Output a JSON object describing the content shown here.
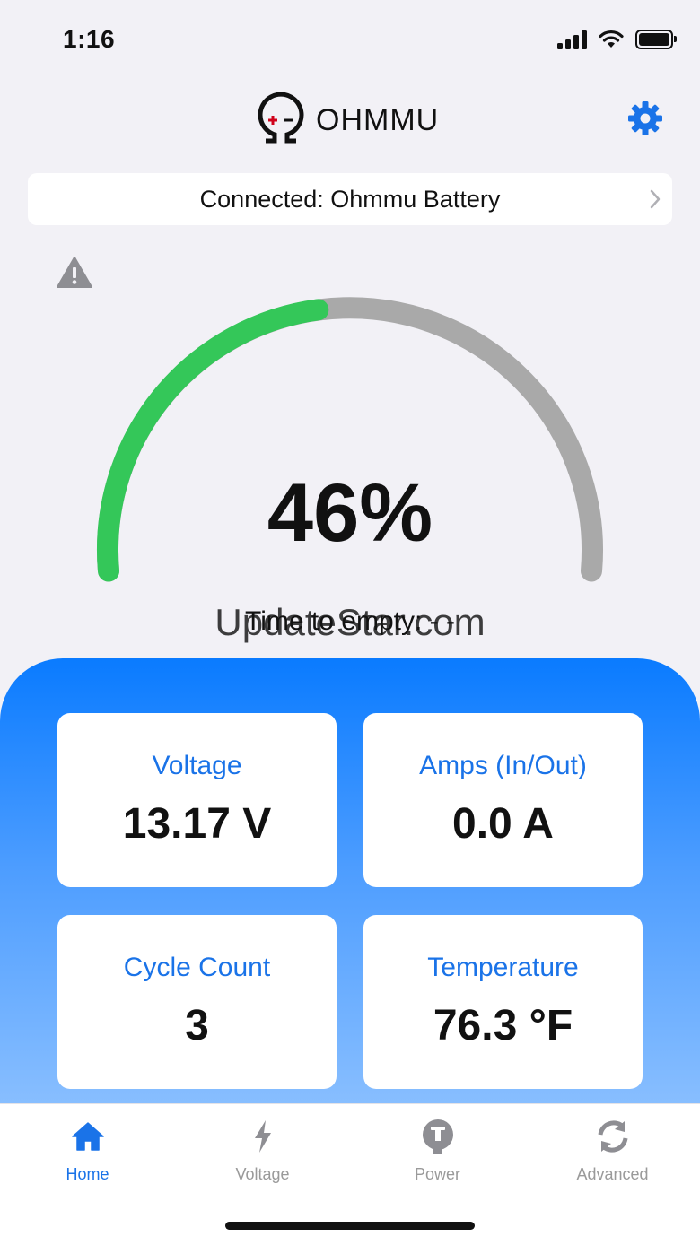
{
  "status_bar": {
    "time": "1:16",
    "icons": [
      "signal-icon",
      "wifi-icon",
      "battery-icon"
    ]
  },
  "header": {
    "logo_text": "OHMMU",
    "settings_icon": "gear-icon"
  },
  "connection": {
    "text": "Connected: Ohmmu Battery",
    "chevron_icon": "chevron-right-icon"
  },
  "warning_icon": "warning-icon",
  "gauge": {
    "percent": 46,
    "display": "46%",
    "subtitle": "Time to empty: - -",
    "fill_color": "#34c759",
    "track_color": "#a9a9a9"
  },
  "watermark": "UpdateStar.com",
  "cards": [
    {
      "label": "Voltage",
      "value": "13.17 V"
    },
    {
      "label": "Amps (In/Out)",
      "value": "0.0 A"
    },
    {
      "label": "Cycle Count",
      "value": "3"
    },
    {
      "label": "Temperature",
      "value": "76.3 °F"
    }
  ],
  "tabs": [
    {
      "label": "Home",
      "icon": "home-icon",
      "active": true
    },
    {
      "label": "Voltage",
      "icon": "lightning-icon",
      "active": false
    },
    {
      "label": "Power",
      "icon": "plug-icon",
      "active": false
    },
    {
      "label": "Advanced",
      "icon": "refresh-icon",
      "active": false
    }
  ],
  "colors": {
    "accent": "#1a73e8",
    "panel_top": "#0a7bff",
    "panel_bottom": "#8dc1ff"
  }
}
